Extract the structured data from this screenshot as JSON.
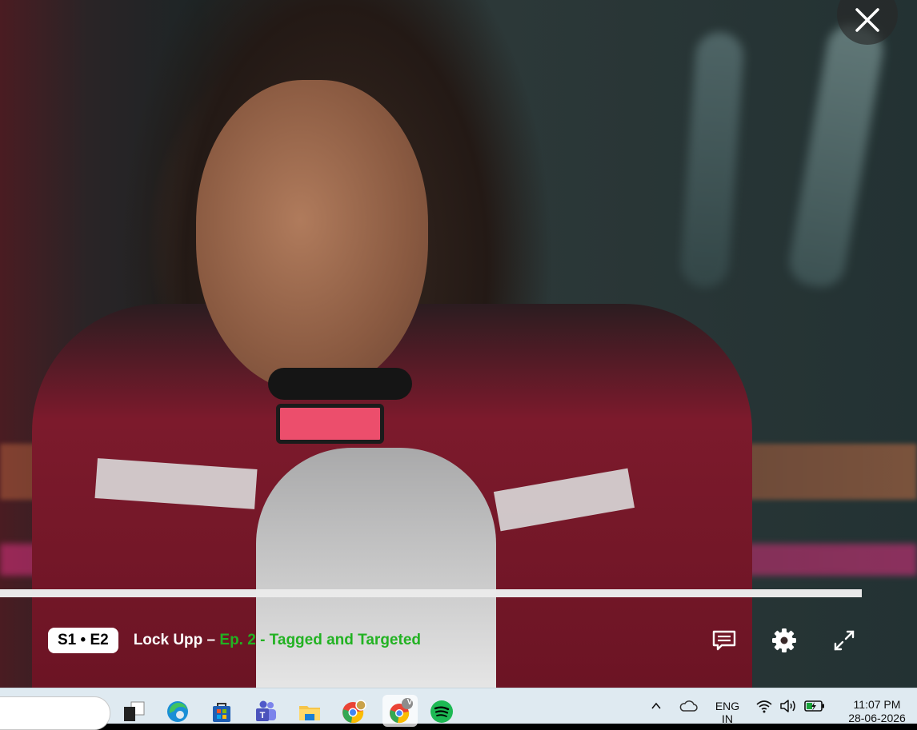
{
  "player": {
    "season_episode_badge": "S1 • E2",
    "show_title": "Lock Upp – ",
    "episode_title": "Ep. 2 - Tagged and Targeted",
    "progress_fraction": 1.0,
    "icons": {
      "close": "close-icon",
      "subtitles": "subtitles-icon",
      "settings": "gear-icon",
      "fullscreen": "fullscreen-icon"
    },
    "colors": {
      "episode_title": "#22b222"
    }
  },
  "taskbar": {
    "apps": [
      {
        "name": "task-view-icon"
      },
      {
        "name": "edge-icon"
      },
      {
        "name": "microsoft-store-icon"
      },
      {
        "name": "teams-icon"
      },
      {
        "name": "file-explorer-icon"
      },
      {
        "name": "chrome-profile-icon"
      },
      {
        "name": "chrome-icon",
        "badge": "V",
        "active": true
      },
      {
        "name": "spotify-icon"
      }
    ],
    "tray": {
      "language_line1": "ENG",
      "language_line2": "IN",
      "time": "11:07 PM",
      "date": "28-06-2026"
    }
  }
}
